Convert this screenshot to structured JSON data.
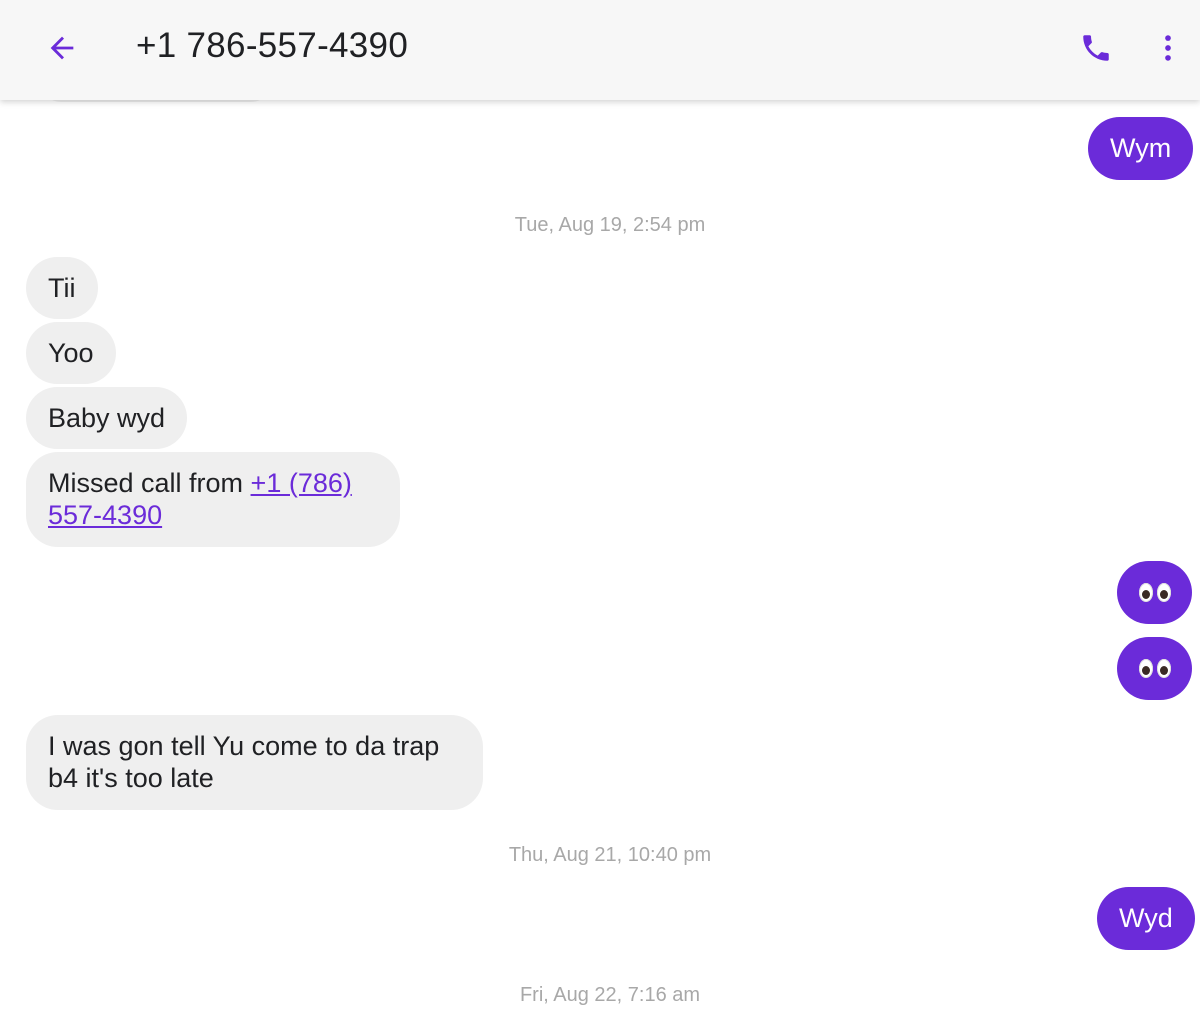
{
  "header": {
    "title": "+1 786-557-4390",
    "back_icon": "arrow-back-icon",
    "call_icon": "phone-icon",
    "menu_icon": "more-vert-icon"
  },
  "colors": {
    "accent": "#6b2bd9",
    "incoming_bubble": "#efefef",
    "timestamp": "#a8a8a8"
  },
  "messages": {
    "m1": "Wym",
    "ts1": "Tue, Aug 19, 2:54 pm",
    "m2": "Tii",
    "m3": "Yoo",
    "m4": "Baby wyd",
    "m5_prefix": "Missed call from ",
    "m5_link_line1": "+1 (786)",
    "m5_link_line2": "557-4390",
    "m6_emoji": "eyes",
    "m7_emoji": "eyes",
    "m8_line1": "I was gon tell Yu come to da trap",
    "m8_line2": "b4 it's too late",
    "ts2": "Thu, Aug 21, 10:40 pm",
    "m9": "Wyd",
    "ts3": "Fri, Aug 22, 7:16 am"
  }
}
